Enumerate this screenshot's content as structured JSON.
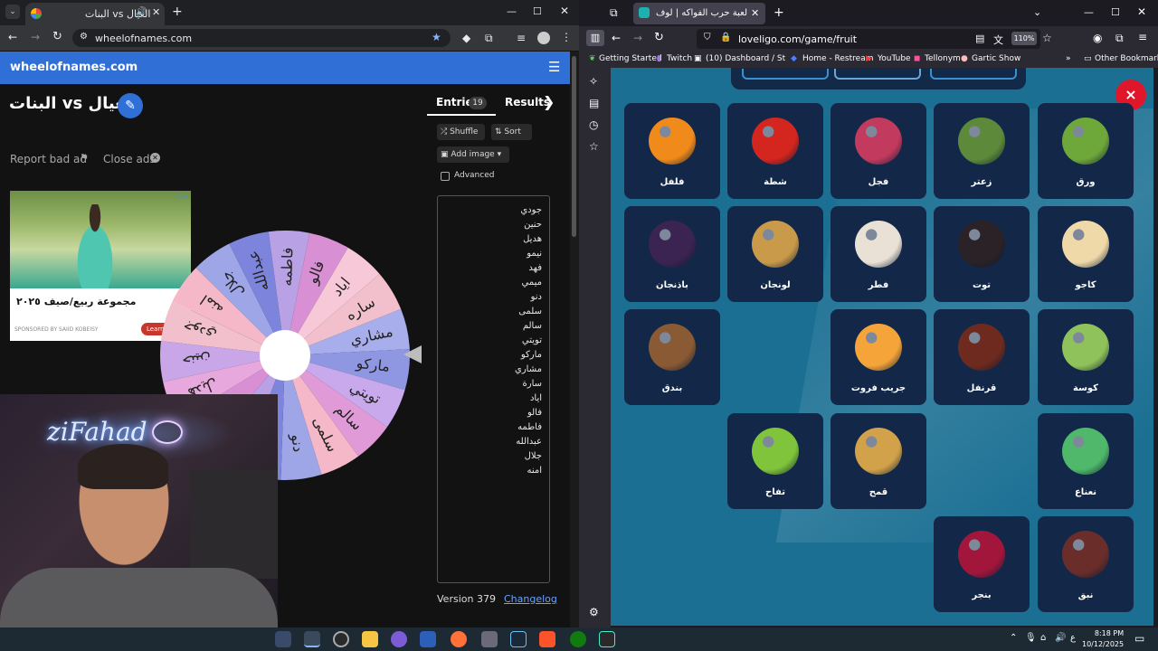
{
  "left_browser": {
    "tab_title": "البنات vs العيال",
    "url": "wheelofnames.com",
    "site_name": "wheelofnames.com"
  },
  "wheel_page": {
    "title": "البنات vs العيال",
    "report_ad": "Report bad ad",
    "close_ads": "Close ads",
    "ad_text": "مجموعة ربيع/صيف ٢٠٢٥",
    "ad_sponsor": "SPONSORED BY SAIID KOBEISY",
    "ad_cta": "Learn",
    "tab_entries": "Entries",
    "entries_count": "19",
    "tab_results": "Results",
    "shuffle": "Shuffle",
    "sort": "Sort",
    "add_image": "Add image",
    "advanced": "Advanced",
    "entries": [
      "جودي",
      "حنين",
      "هديل",
      "نيمو",
      "فهد",
      "ميمي",
      "دنو",
      "سلمى",
      "سالم",
      "تويتي",
      "ماركو",
      "مشاري",
      "سارة",
      "اياد",
      "فالو",
      "فاطمه",
      "عبدالله",
      "جلال",
      "امنه"
    ],
    "version": "Version 379",
    "changelog": "Changelog",
    "wheel_labels": [
      "امنه",
      "جلال",
      "عبدالله",
      "فاطمه",
      "فالو",
      "اياد",
      "ساره",
      "مشاري",
      "ماركو",
      "تويتي",
      "سالم",
      "سلمى",
      "دنو",
      "ميمي",
      "فهد",
      "نيمو",
      "هديل",
      "حنين",
      "جودي"
    ],
    "wheel_colors": [
      "#f4b8c8",
      "#9ea6e8",
      "#7c84dc",
      "#b9a1e6",
      "#d88fd4",
      "#f7c9d8",
      "#f2c0cc",
      "#a8aeec",
      "#8f97e2",
      "#c8a9ec",
      "#e19ad8",
      "#f4b8c8",
      "#9ea6e8",
      "#7c84dc",
      "#b9a1e6",
      "#d88fd4",
      "#e7a9dd",
      "#c9a6e7",
      "#f2c0cc"
    ]
  },
  "webcam": {
    "neon_text": "ziFahad"
  },
  "right_browser": {
    "tab_title": "لعبة حرب الفواكه | لوف ليجو يو...",
    "url": "loveligo.com/game/fruit",
    "zoom": "110%",
    "bookmarks": [
      "Getting Started",
      "Twitch",
      "(10) Dashboard / Strea...",
      "Home - Restream",
      "YouTube",
      "Tellonym",
      "Gartic Show"
    ],
    "other_bookmarks": "Other Bookmarks"
  },
  "game": {
    "close": "×",
    "cards": [
      {
        "name": "فلفل",
        "icon": "pepper-icon",
        "color": "#f08a1a"
      },
      {
        "name": "شطة",
        "icon": "chili-icon",
        "color": "#d4261e"
      },
      {
        "name": "فجل",
        "icon": "radish-icon",
        "color": "#c23a5e"
      },
      {
        "name": "زعتر",
        "icon": "thyme-icon",
        "color": "#5d8a3a"
      },
      {
        "name": "ورق",
        "icon": "leaf-icon",
        "color": "#6fa83a"
      },
      {
        "name": "باذنجان",
        "icon": "eggplant-icon",
        "color": "#3b2352"
      },
      {
        "name": "لونجان",
        "icon": "longan-icon",
        "color": "#c99a4a"
      },
      {
        "name": "فطر",
        "icon": "mushroom-icon",
        "color": "#e9e1d6"
      },
      {
        "name": "توت",
        "icon": "blackberry-icon",
        "color": "#2a2226"
      },
      {
        "name": "كاجو",
        "icon": "cashew-icon",
        "color": "#efd9a8"
      },
      {
        "name": "بندق",
        "icon": "hazelnut-icon",
        "color": "#8a5a34"
      },
      {
        "name": "جريب فروت",
        "icon": "grapefruit-icon",
        "color": "#f5a43a"
      },
      {
        "name": "قرنفل",
        "icon": "clove-icon",
        "color": "#6e2a1e"
      },
      {
        "name": "كوسة",
        "icon": "zucchini-icon",
        "color": "#8fc25a"
      },
      {
        "name": "تفاح",
        "icon": "apple-icon",
        "color": "#7fc43a"
      },
      {
        "name": "قمح",
        "icon": "wheat-icon",
        "color": "#d2a24a"
      },
      {
        "name": "نعناع",
        "icon": "mint-icon",
        "color": "#4fb86a"
      },
      {
        "name": "بنجر",
        "icon": "beetroot-icon",
        "color": "#a3163c"
      },
      {
        "name": "نبق",
        "icon": "jujube-icon",
        "color": "#6a2d2a"
      }
    ]
  },
  "taskbar": {
    "time": "8:18 PM",
    "date": "10/12/2025",
    "lang": "ع"
  }
}
